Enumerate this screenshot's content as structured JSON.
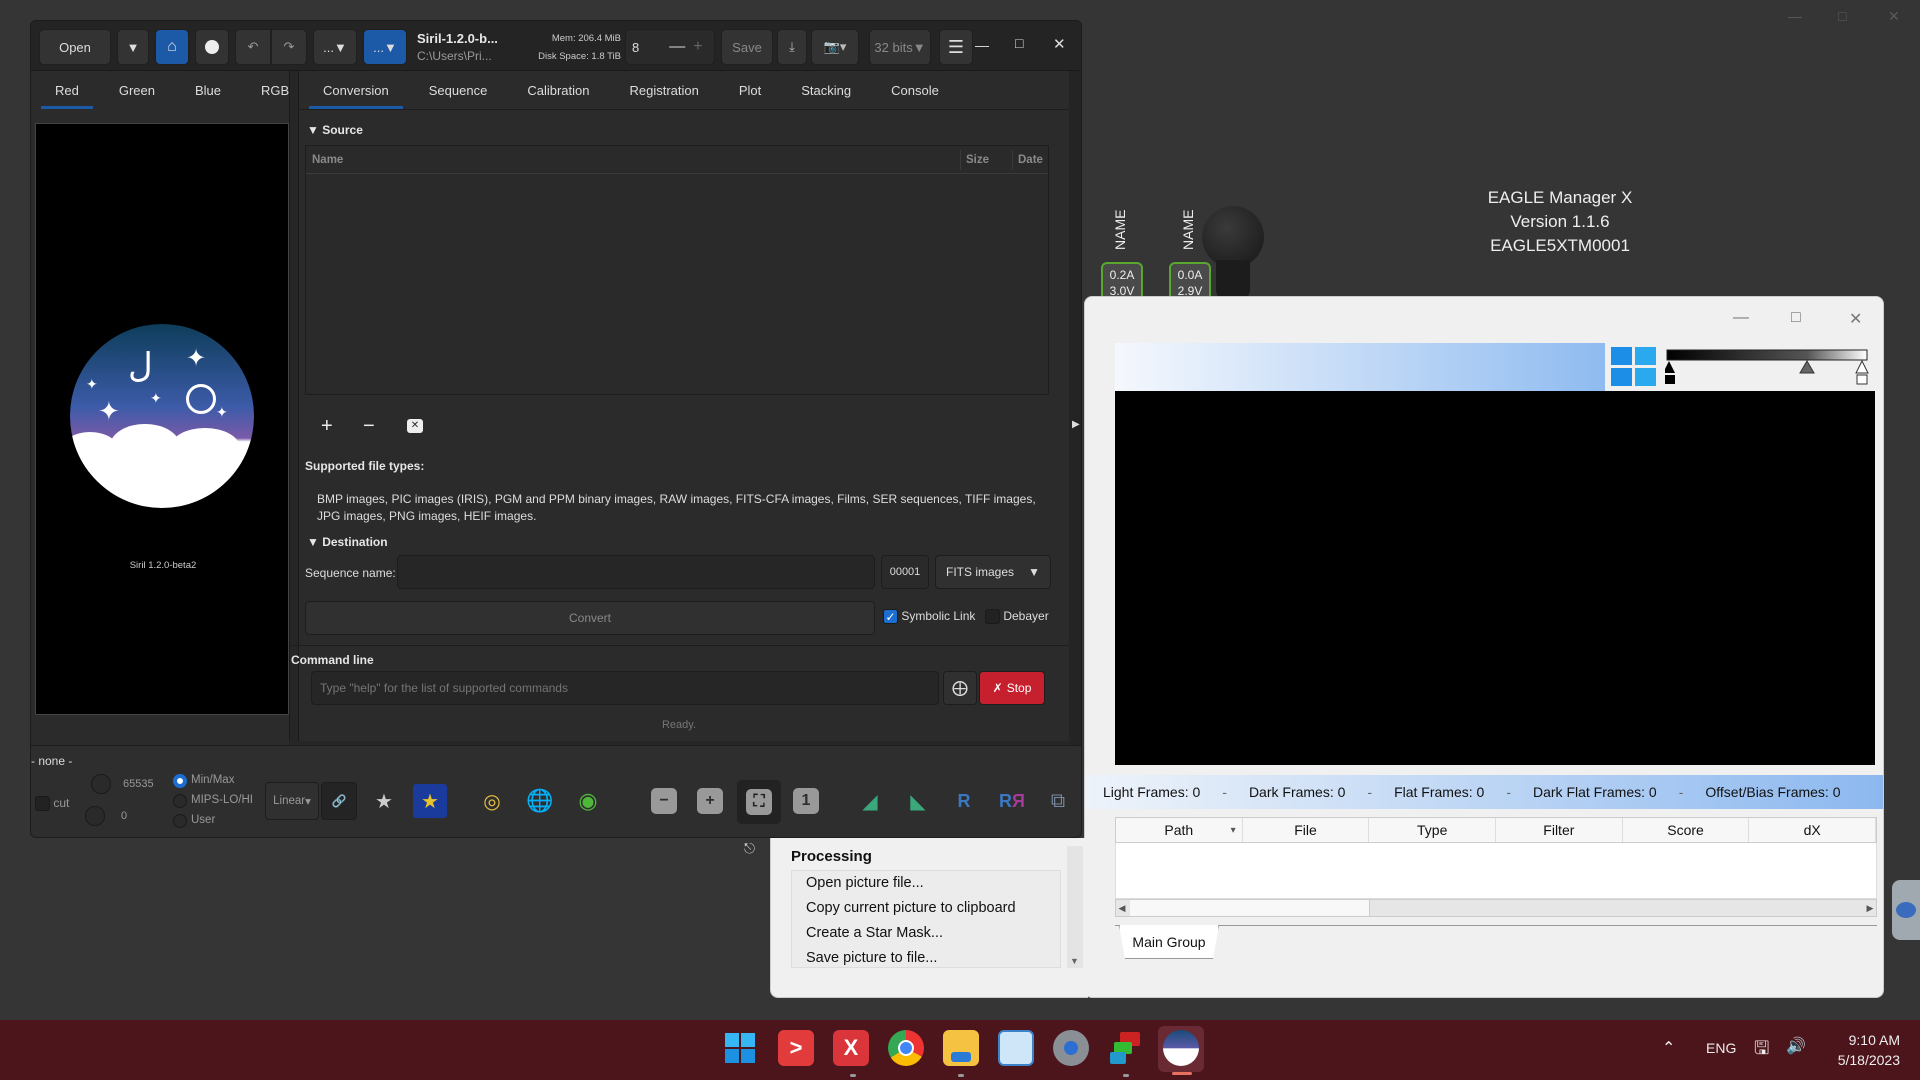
{
  "siril": {
    "toolbar": {
      "open_label": "Open",
      "title": "Siril-1.2.0-b...",
      "path": "C:\\Users\\Pri...",
      "mem": "Mem: 206.4 MiB",
      "disk": "Disk Space: 1.8 TiB",
      "thread_value": "8",
      "save_label": "Save",
      "bits_label": "32 bits",
      "more1_label": "...",
      "more2_label": "..."
    },
    "channel_tabs": [
      "Red",
      "Green",
      "Blue",
      "RGB"
    ],
    "active_channel": "Red",
    "main_tabs": [
      "Conversion",
      "Sequence",
      "Calibration",
      "Registration",
      "Plot",
      "Stacking",
      "Console"
    ],
    "active_tab": "Conversion",
    "logo_caption": "Siril 1.2.0-beta2",
    "source": {
      "header": "Source",
      "columns": [
        "Name",
        "Size",
        "Date"
      ],
      "rows": []
    },
    "supported": {
      "label": "Supported file types:",
      "text": "BMP images, PIC images (IRIS), PGM and PPM binary images, RAW images, FITS-CFA images, Films, SER sequences, TIFF images, JPG images, PNG images, HEIF images."
    },
    "destination": {
      "header": "Destination",
      "seq_label": "Sequence name:",
      "seq_value": "",
      "start_index": "00001",
      "format": "FITS images",
      "convert_label": "Convert",
      "symbolic_link_label": "Symbolic Link",
      "symbolic_link_checked": true,
      "debayer_label": "Debayer",
      "debayer_checked": false
    },
    "command": {
      "header": "Command line",
      "placeholder": "Type \"help\" for the list of supported commands",
      "stop_label": "Stop",
      "status": "Ready."
    },
    "bottom": {
      "image_name": "- none -",
      "cut_label": "cut",
      "hi_value": "65535",
      "lo_value": "0",
      "modes": [
        "Min/Max",
        "MIPS-LO/HI",
        "User"
      ],
      "selected_mode": "Min/Max",
      "stretch": "Linear"
    }
  },
  "eagle": {
    "title_lines": [
      "EAGLE Manager X",
      "Version 1.1.6",
      "EAGLE5XTM0001"
    ],
    "channels": [
      {
        "name": "NAME",
        "current": "0.2A",
        "voltage": "3.0V"
      },
      {
        "name": "NAME",
        "current": "0.0A",
        "voltage": "2.9V"
      }
    ]
  },
  "frames_window": {
    "stats": [
      "Light Frames: 0",
      "-",
      "Dark Frames: 0",
      "-",
      "Flat Frames: 0",
      "-",
      "Dark Flat Frames: 0",
      "-",
      "Offset/Bias Frames: 0"
    ],
    "columns": [
      "Path",
      "File",
      "Type",
      "Filter",
      "Score",
      "dX"
    ],
    "rows": [],
    "group_tab": "Main Group"
  },
  "processing": {
    "header": "Processing",
    "items": [
      "Open picture file...",
      "Copy current picture to clipboard",
      "Create a Star Mask...",
      "Save picture to file..."
    ]
  },
  "taskbar": {
    "tray": {
      "lang": "ENG",
      "time": "9:10 AM",
      "date": "5/18/2023"
    }
  }
}
